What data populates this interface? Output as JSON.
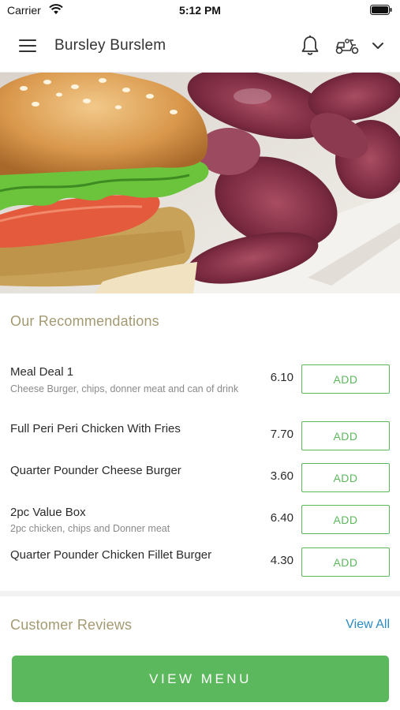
{
  "status_bar": {
    "carrier": "Carrier",
    "time": "5:12 PM"
  },
  "header": {
    "location": "Bursley Burslem",
    "icons": [
      "hamburger-icon",
      "bell-icon",
      "scooter-icon",
      "chevron-down-icon"
    ]
  },
  "hero": {
    "description": "photo",
    "icon": "burger-and-chips-photo"
  },
  "recommendations": {
    "title": "Our Recommendations",
    "items": [
      {
        "name": "Meal Deal 1",
        "description": "Cheese Burger, chips, donner meat and can of drink",
        "price": "6.10",
        "add_label": "ADD"
      },
      {
        "name": "Full Peri Peri Chicken With Fries",
        "description": "",
        "price": "7.70",
        "add_label": "ADD"
      },
      {
        "name": "Quarter Pounder Cheese Burger",
        "description": "",
        "price": "3.60",
        "add_label": "ADD"
      },
      {
        "name": "2pc Value Box",
        "description": "2pc chicken, chips and Donner meat",
        "price": "6.40",
        "add_label": "ADD"
      },
      {
        "name": "Quarter Pounder Chicken Fillet Burger",
        "description": "",
        "price": "4.30",
        "add_label": "ADD"
      }
    ]
  },
  "reviews": {
    "title": "Customer Reviews",
    "view_all": "View All"
  },
  "cta": {
    "view_menu": "VIEW MENU"
  },
  "colors": {
    "accent_green": "#5cb85c",
    "section_title": "#a39a72",
    "link_blue": "#2a8ac4"
  }
}
